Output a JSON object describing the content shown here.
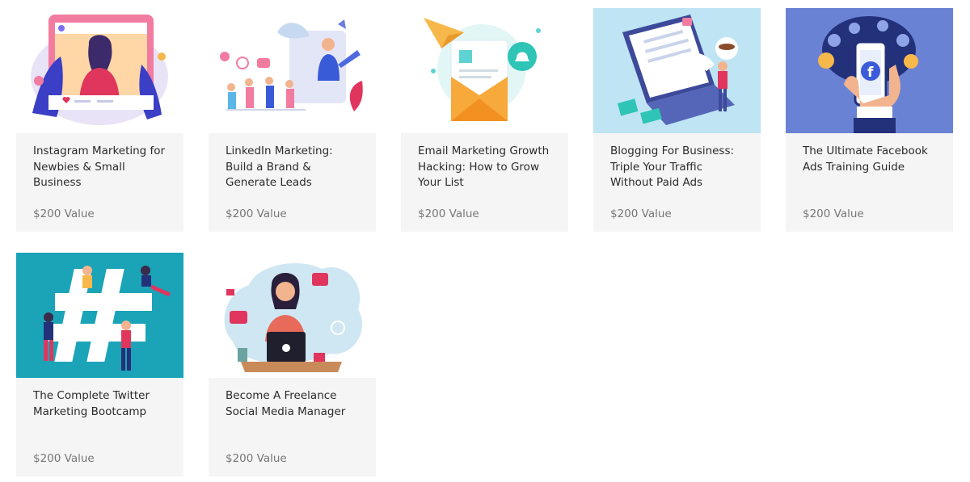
{
  "courses": [
    {
      "title": "Instagram Marketing for Newbies & Small Business",
      "price": "$200 Value",
      "image_icon": "instagram-illustration-icon",
      "bg": "#ffffff"
    },
    {
      "title": "LinkedIn Marketing: Build a Brand & Generate Leads",
      "price": "$200 Value",
      "image_icon": "linkedin-illustration-icon",
      "bg": "#ffffff"
    },
    {
      "title": "Email Marketing Growth Hacking: How to Grow Your List",
      "price": "$200 Value",
      "image_icon": "email-envelope-icon",
      "bg": "#ffffff"
    },
    {
      "title": "Blogging For Business: Triple Your Traffic Without Paid Ads",
      "price": "$200 Value",
      "image_icon": "laptop-blog-icon",
      "bg": "#bfe4f4"
    },
    {
      "title": "The Ultimate Facebook Ads Training Guide",
      "price": "$200 Value",
      "image_icon": "facebook-phone-icon",
      "bg": "#6a82d4"
    },
    {
      "title": "The Complete Twitter Marketing Bootcamp",
      "price": "$200 Value",
      "image_icon": "hashtag-icon",
      "bg": "#1ba3b8"
    },
    {
      "title": "Become A Freelance Social Media Manager",
      "price": "$200 Value",
      "image_icon": "freelancer-laptop-icon",
      "bg": "#ffffff"
    }
  ]
}
